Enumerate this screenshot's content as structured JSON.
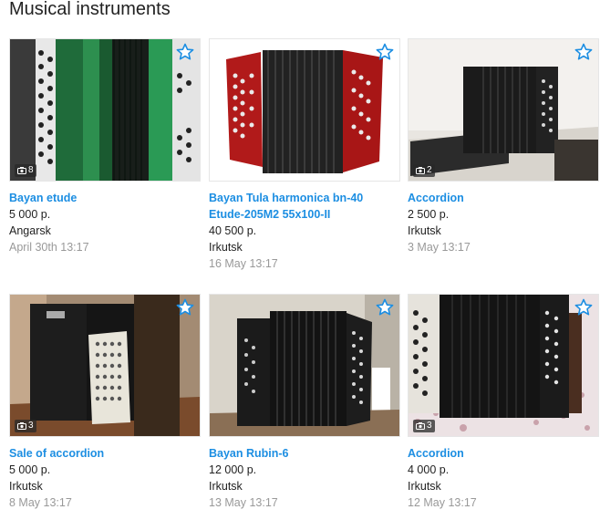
{
  "page": {
    "title": "Musical instruments"
  },
  "icons": {
    "favorite": "star-outline-icon",
    "photos": "camera-icon"
  },
  "colors": {
    "link": "#1c8ee2",
    "star": "#1c8ee2",
    "muted": "#999999"
  },
  "listings": [
    {
      "title": "Bayan etude",
      "price": "5 000 р.",
      "city": "Angarsk",
      "date": "April 30th 13:17",
      "photo_count": "8"
    },
    {
      "title": "Bayan Tula harmonica bn-40 Etude-205M2 55x100-II",
      "price": "40 500 р.",
      "city": "Irkutsk",
      "date": "16 May 13:17",
      "photo_count": ""
    },
    {
      "title": "Accordion",
      "price": "2 500 р.",
      "city": "Irkutsk",
      "date": "3 May 13:17",
      "photo_count": "2"
    },
    {
      "title": "Sale of accordion",
      "price": "5 000 р.",
      "city": "Irkutsk",
      "date": "8 May 13:17",
      "photo_count": "3"
    },
    {
      "title": "Bayan Rubin-6",
      "price": "12 000 р.",
      "city": "Irkutsk",
      "date": "13 May 13:17",
      "photo_count": ""
    },
    {
      "title": "Accordion",
      "price": "4 000 р.",
      "city": "Irkutsk",
      "date": "12 May 13:17",
      "photo_count": "3"
    }
  ]
}
